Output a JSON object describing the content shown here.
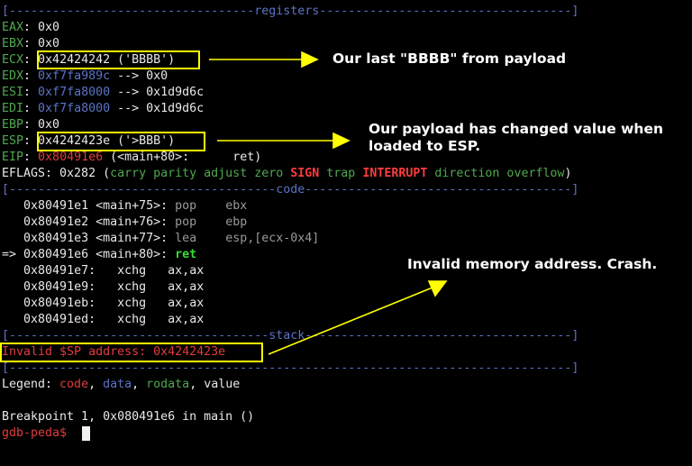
{
  "terminal": {
    "separators": {
      "registers": "[----------------------------------registers-----------------------------------]",
      "code": "[-------------------------------------code-------------------------------------]",
      "stack": "[------------------------------------stack-------------------------------------]",
      "end": "[------------------------------------------------------------------------------]"
    },
    "registers": [
      {
        "name": "EAX",
        "sep": ": ",
        "value": "0x0",
        "rest": ""
      },
      {
        "name": "EBX",
        "sep": ": ",
        "value": "0x0",
        "rest": ""
      },
      {
        "name": "ECX",
        "sep": ": ",
        "value": "0x42424242 ('BBBB')",
        "rest": ""
      },
      {
        "name": "EDX",
        "sep": ": ",
        "value": "0xf7fa989c",
        "rest": " --> 0x0"
      },
      {
        "name": "ESI",
        "sep": ": ",
        "value": "0xf7fa8000",
        "rest": " --> 0x1d9d6c"
      },
      {
        "name": "EDI",
        "sep": ": ",
        "value": "0xf7fa8000",
        "rest": " --> 0x1d9d6c"
      },
      {
        "name": "EBP",
        "sep": ": ",
        "value": "0x0",
        "rest": ""
      },
      {
        "name": "ESP",
        "sep": ": ",
        "value": "0x4242423e ('>BBB')",
        "rest": ""
      },
      {
        "name": "EIP",
        "sep": ": ",
        "value": "0x80491e6",
        "rest": " (<main+80>:      ret)"
      }
    ],
    "eflags": {
      "label": "EFLAGS: 0x282 (",
      "flags": [
        {
          "text": "carry parity adjust zero ",
          "style": "green"
        },
        {
          "text": "SIGN",
          "style": "redb"
        },
        {
          "text": " trap ",
          "style": "green"
        },
        {
          "text": "INTERRUPT",
          "style": "redb"
        },
        {
          "text": " direction overflow",
          "style": "green"
        }
      ],
      "close": ")"
    },
    "code": [
      {
        "prefix": "   ",
        "addr": "0x80491e1",
        "sym": " <main+75>:",
        "mnem": " pop    ",
        "ops": "ebx"
      },
      {
        "prefix": "   ",
        "addr": "0x80491e2",
        "sym": " <main+76>:",
        "mnem": " pop    ",
        "ops": "ebp"
      },
      {
        "prefix": "   ",
        "addr": "0x80491e3",
        "sym": " <main+77>:",
        "mnem": " lea    ",
        "ops": "esp,[ecx-0x4]"
      },
      {
        "prefix": "=> ",
        "addr": "0x80491e6",
        "sym": " <main+80>:",
        "mnem": " ret",
        "ops": ""
      },
      {
        "prefix": "   ",
        "addr": "0x80491e7",
        "sym": ":",
        "mnem": "   xchg   ",
        "ops": "ax,ax"
      },
      {
        "prefix": "   ",
        "addr": "0x80491e9",
        "sym": ":",
        "mnem": "   xchg   ",
        "ops": "ax,ax"
      },
      {
        "prefix": "   ",
        "addr": "0x80491eb",
        "sym": ":",
        "mnem": "   xchg   ",
        "ops": "ax,ax"
      },
      {
        "prefix": "   ",
        "addr": "0x80491ed",
        "sym": ":",
        "mnem": "   xchg   ",
        "ops": "ax,ax"
      }
    ],
    "stack_error": "Invalid $SP address: 0x4242423e",
    "legend": {
      "label": "Legend: ",
      "code": "code",
      "comma1": ", ",
      "data": "data",
      "comma2": ", ",
      "rodata": "rodata",
      "comma3": ", ",
      "value": "value"
    },
    "breakpoint": "Breakpoint 1, 0x080491e6 in main ()",
    "prompt": "gdb-peda$ "
  },
  "annotations": {
    "ecx_note": "Our last \"BBBB\" from payload",
    "esp_note_line1": "Our payload has changed value when",
    "esp_note_line2": "loaded to ESP.",
    "crash_note": "Invalid memory address. Crash.",
    "box_color": "#ffff00",
    "arrow_color": "#ffff00"
  },
  "colors": {
    "background": "#000000",
    "separator": "#5b73c6",
    "register_name": "#4fa84f",
    "pointer_value": "#5b73c6",
    "code_address": "#e03c3c",
    "current_instruction": "#36d936",
    "error": "#e03c3c",
    "prompt": "#e03c3c"
  }
}
